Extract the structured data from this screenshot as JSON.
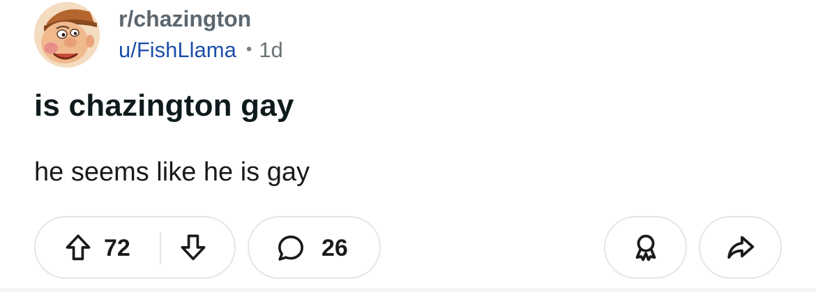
{
  "post": {
    "subreddit": "r/chazington",
    "author": "u/FishLlama",
    "separator": "•",
    "age": "1d",
    "title": "is chazington gay",
    "body": "he seems like he is gay"
  },
  "actions": {
    "upvote_icon": "arrow-up-icon",
    "score": "72",
    "downvote_icon": "arrow-down-icon",
    "comment_icon": "speech-bubble-icon",
    "comment_count": "26",
    "award_icon": "award-icon",
    "share_icon": "share-arrow-icon"
  },
  "colors": {
    "subreddit": "#5c6770",
    "author_link": "#1d4fa8",
    "pill_border": "#e3e6e8",
    "text": "#1a1a1b"
  }
}
